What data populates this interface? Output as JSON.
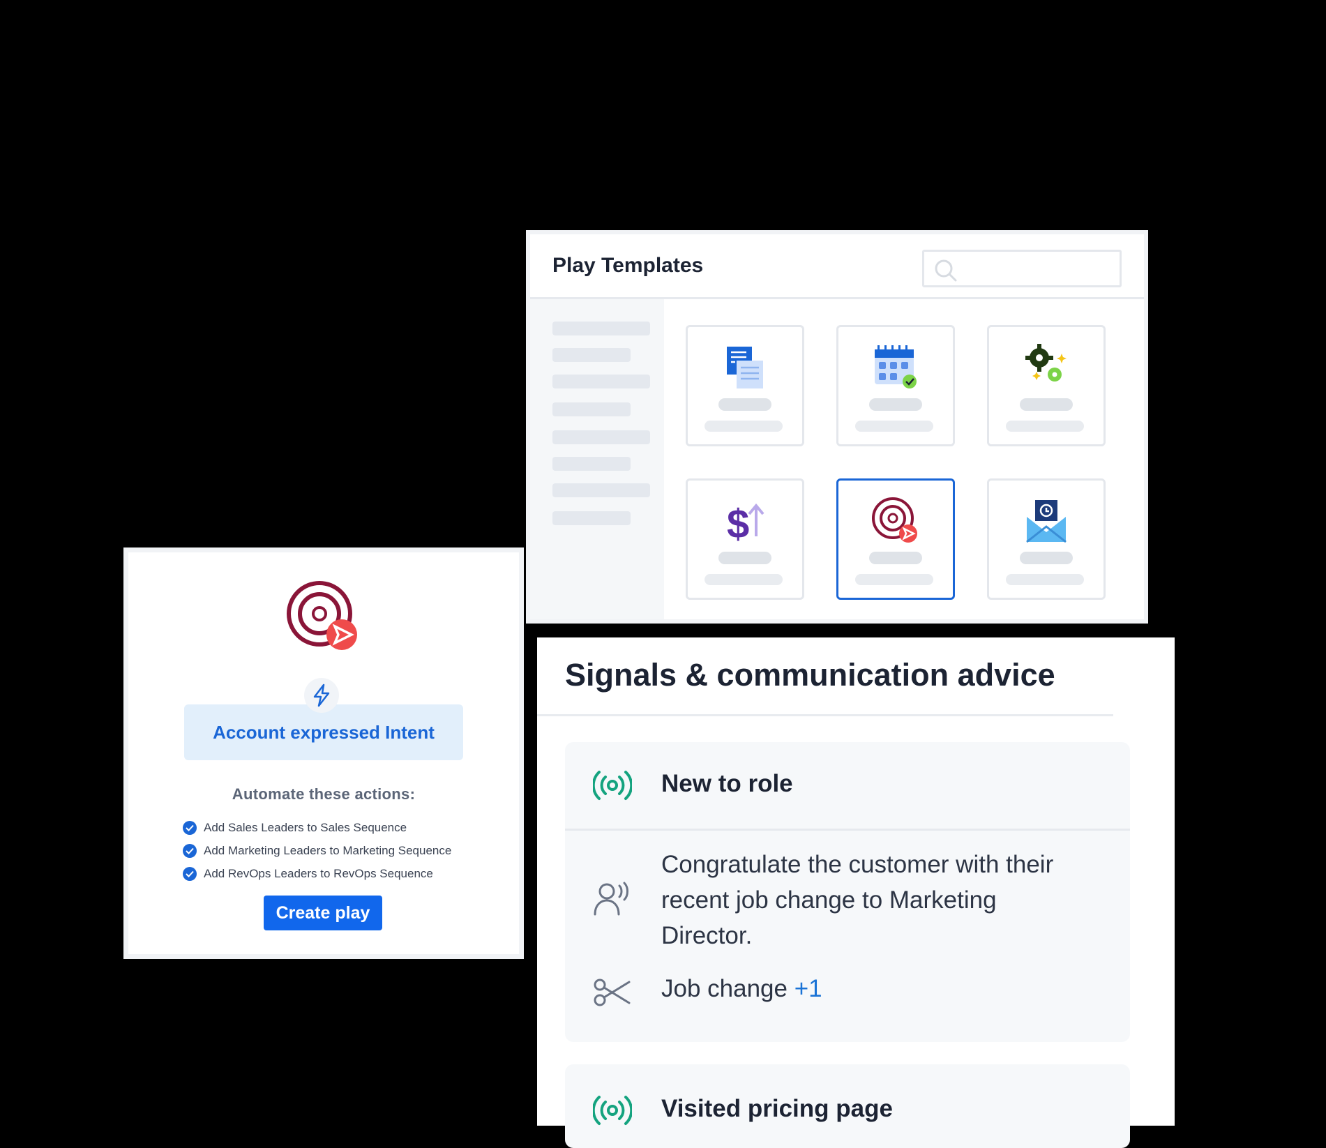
{
  "play_templates": {
    "title": "Play Templates",
    "search_placeholder": "",
    "templates": [
      {
        "icon": "document-list-icon"
      },
      {
        "icon": "calendar-check-icon"
      },
      {
        "icon": "gears-sparkle-icon"
      },
      {
        "icon": "dollar-growth-icon"
      },
      {
        "icon": "target-send-icon",
        "selected": true
      },
      {
        "icon": "envelope-refresh-icon"
      }
    ]
  },
  "play_card": {
    "icon": "target-send-icon",
    "trigger_icon": "lightning-icon",
    "trigger": "Account expressed Intent",
    "actions_heading": "Automate these actions:",
    "actions": [
      "Add Sales Leaders to Sales Sequence",
      "Add Marketing Leaders to Marketing Sequence",
      "Add RevOps Leaders to RevOps Sequence"
    ],
    "button": "Create play"
  },
  "signals": {
    "title": "Signals & communication advice",
    "items": [
      {
        "icon": "broadcast-icon",
        "label": "New to role",
        "advice_icon": "speaking-person-icon",
        "advice": "Congratulate the customer with their recent job change to Marketing Director.",
        "tag_icon": "scissors-icon",
        "tag": "Job change",
        "tag_extra": "+1"
      },
      {
        "icon": "broadcast-icon",
        "label": "Visited pricing page"
      }
    ]
  },
  "colors": {
    "accent": "#1167ec",
    "signal_green": "#14a37f",
    "target_maroon": "#8a1538",
    "send_red": "#ef4b4b",
    "background": "#000000"
  }
}
